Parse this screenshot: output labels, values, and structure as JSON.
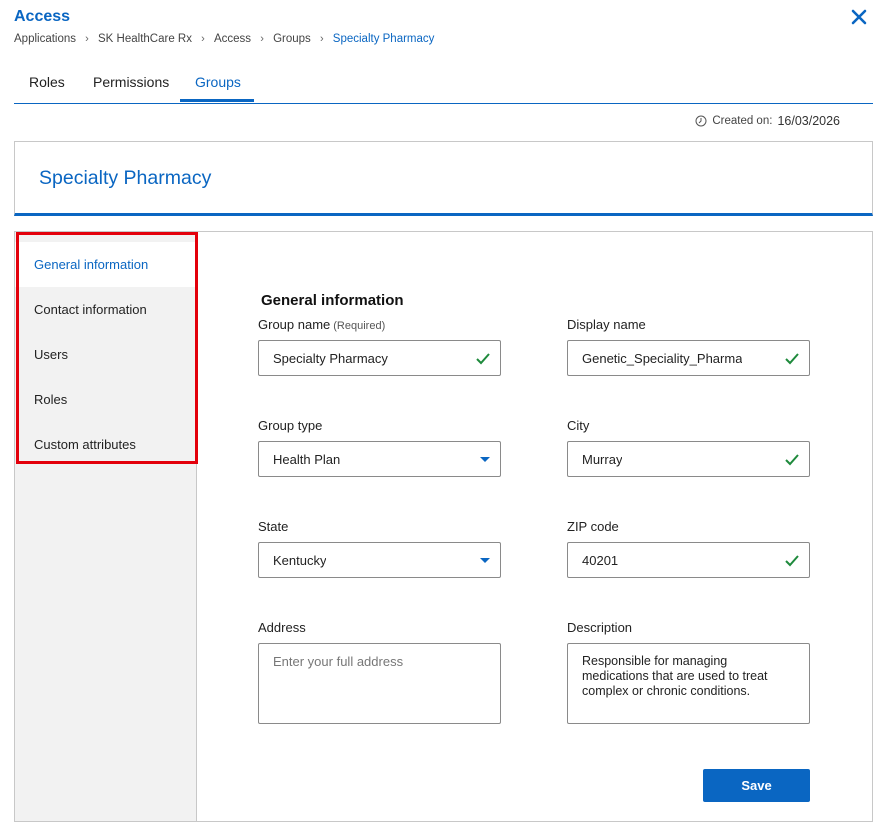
{
  "app": {
    "title": "Access"
  },
  "breadcrumb": [
    "Applications",
    "SK HealthCare Rx",
    "Access",
    "Groups",
    "Specialty Pharmacy"
  ],
  "tabs": [
    {
      "label": "Roles",
      "active": false
    },
    {
      "label": "Permissions",
      "active": false
    },
    {
      "label": "Groups",
      "active": true
    }
  ],
  "created": {
    "label": "Created on:",
    "date": "16/03/2026"
  },
  "group": {
    "title": "Specialty Pharmacy"
  },
  "sidebar": {
    "items": [
      {
        "label": "General information",
        "active": true
      },
      {
        "label": "Contact information",
        "active": false
      },
      {
        "label": "Users",
        "active": false
      },
      {
        "label": "Roles",
        "active": false
      },
      {
        "label": "Custom attributes",
        "active": false
      }
    ]
  },
  "form": {
    "heading": "General information",
    "group_name": {
      "label": "Group name",
      "required": "(Required)",
      "value": "Specialty Pharmacy",
      "valid": true
    },
    "display_name": {
      "label": "Display name",
      "value": "Genetic_Speciality_Pharma",
      "valid": true
    },
    "group_type": {
      "label": "Group type",
      "value": "Health Plan"
    },
    "city": {
      "label": "City",
      "value": "Murray",
      "valid": true
    },
    "state": {
      "label": "State",
      "value": "Kentucky"
    },
    "zip": {
      "label": "ZIP code",
      "value": "40201",
      "valid": true
    },
    "address": {
      "label": "Address",
      "placeholder": "Enter your full address",
      "value": ""
    },
    "description": {
      "label": "Description",
      "value": "Responsible for managing medications that are used to treat complex or chronic conditions."
    },
    "save_label": "Save"
  },
  "colors": {
    "accent": "#0a66c2",
    "valid": "#1e8a3c",
    "highlight": "#e3000b"
  }
}
